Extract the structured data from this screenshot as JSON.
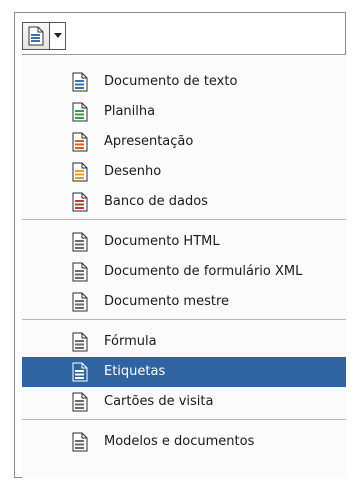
{
  "toolbar": {
    "new_button_icon": "new-document-icon",
    "dropdown_icon": "dropdown-arrow-icon"
  },
  "menu": {
    "groups": [
      [
        {
          "label": "Documento de texto",
          "icon": "text-document-icon",
          "color": "#3f6fb0"
        },
        {
          "label": "Planilha",
          "icon": "spreadsheet-icon",
          "color": "#3f9a3f"
        },
        {
          "label": "Apresentação",
          "icon": "presentation-icon",
          "color": "#e05a1e"
        },
        {
          "label": "Desenho",
          "icon": "drawing-icon",
          "color": "#e0a020"
        },
        {
          "label": "Banco de dados",
          "icon": "database-icon",
          "color": "#c0392b"
        }
      ],
      [
        {
          "label": "Documento HTML",
          "icon": "html-document-icon",
          "color": "#6a6a6a"
        },
        {
          "label": "Documento de formulário XML",
          "icon": "xml-form-icon",
          "color": "#6a6a6a"
        },
        {
          "label": "Documento mestre",
          "icon": "master-document-icon",
          "color": "#6a6a6a"
        }
      ],
      [
        {
          "label": "Fórmula",
          "icon": "formula-icon",
          "color": "#6a6a6a"
        },
        {
          "label": "Etiquetas",
          "icon": "labels-icon",
          "color": "#ffffff",
          "selected": true
        },
        {
          "label": "Cartões de visita",
          "icon": "business-cards-icon",
          "color": "#6a6a6a"
        }
      ],
      [
        {
          "label": "Modelos e documentos",
          "icon": "templates-documents-icon",
          "color": "#6a6a6a"
        }
      ]
    ]
  }
}
